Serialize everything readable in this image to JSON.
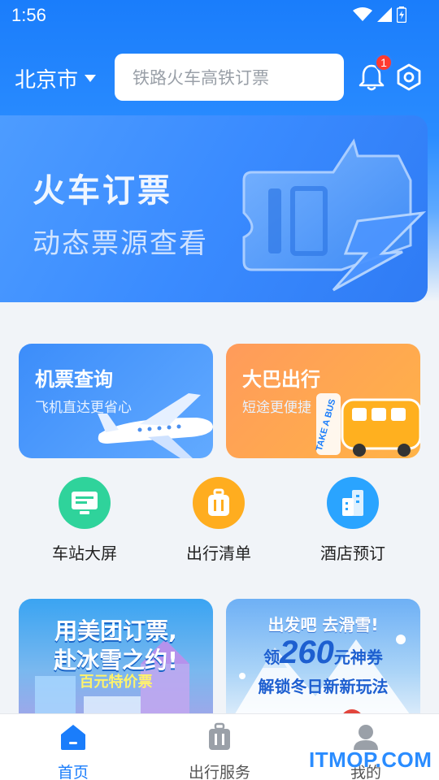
{
  "status": {
    "time": "1:56"
  },
  "topbar": {
    "city": "北京市",
    "search_placeholder": "铁路火车高铁订票",
    "notification_count": "1"
  },
  "banner": {
    "title": "火车订票",
    "subtitle": "动态票源查看"
  },
  "cards": [
    {
      "title": "机票查询",
      "subtitle": "飞机直达更省心"
    },
    {
      "title": "大巴出行",
      "subtitle": "短途更便捷",
      "art_text": "TAKE A BUS"
    }
  ],
  "quick_actions": [
    {
      "label": "车站大屏",
      "icon": "monitor-icon",
      "color": "#2fd39b"
    },
    {
      "label": "出行清单",
      "icon": "suitcase-icon",
      "color": "#ffad1f"
    },
    {
      "label": "酒店预订",
      "icon": "building-icon",
      "color": "#2aa4ff"
    }
  ],
  "promos": [
    {
      "line1": "用美团订票,",
      "line2": "赴冰雪之约!",
      "line3": "百元特价票"
    },
    {
      "line1": "出发吧 去滑雪!",
      "line2a": "领",
      "line2b": "260",
      "line2c": "元",
      "line2d": "神券",
      "line3": "解锁冬日新新玩法"
    }
  ],
  "tabbar": {
    "items": [
      {
        "label": "首页",
        "icon": "home-icon",
        "active": true
      },
      {
        "label": "出行服务",
        "icon": "briefcase-icon",
        "active": false
      },
      {
        "label": "我的",
        "icon": "user-icon",
        "active": false
      }
    ]
  },
  "watermark": "ITMOP.COM",
  "colors": {
    "accent": "#1a7dfb",
    "header": "#2a8cff",
    "badge": "#ff3b30"
  }
}
